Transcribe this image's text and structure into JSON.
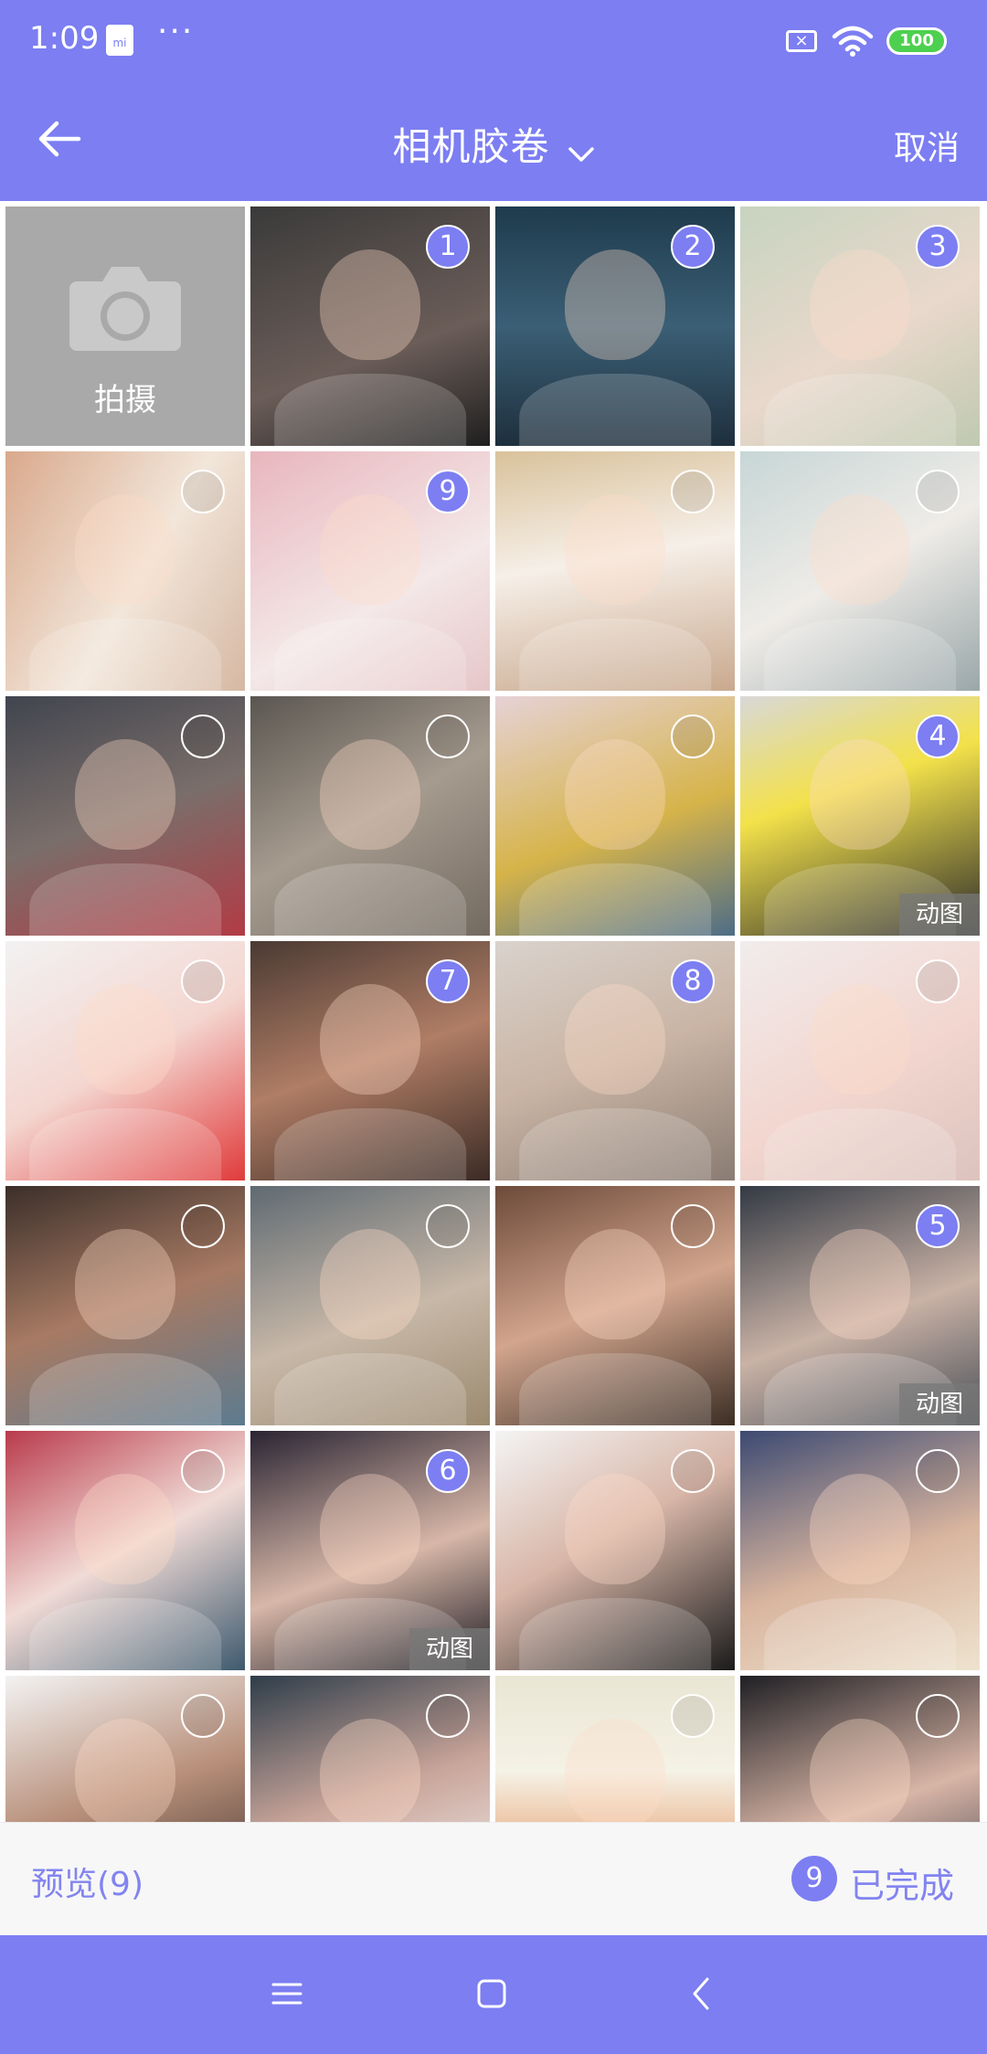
{
  "status": {
    "time": "1:09",
    "battery": "100"
  },
  "header": {
    "title": "相机胶卷",
    "cancel_label": "取消"
  },
  "camera": {
    "label": "拍摄"
  },
  "grid": {
    "photos": [
      {
        "selection": "1",
        "gif": "",
        "bg": "linear-gradient(160deg,#3a3a3a,#6b5d58 60%,#1f1f1f)"
      },
      {
        "selection": "2",
        "gif": "",
        "bg": "linear-gradient(180deg,#1f3b4d,#3b5f75 50%,#1e2f3d)"
      },
      {
        "selection": "3",
        "gif": "",
        "bg": "linear-gradient(150deg,#c7d4c0,#e9d8cc 55%,#bfc9b0)"
      },
      {
        "selection": "",
        "gif": "",
        "bg": "linear-gradient(120deg,#d9a98c,#f2e6da 55%,#d6b8a3)"
      },
      {
        "selection": "9",
        "gif": "",
        "bg": "linear-gradient(150deg,#e8b6bd,#f4e8e8 60%,#e6c6c8)"
      },
      {
        "selection": "",
        "gif": "",
        "bg": "linear-gradient(170deg,#d9c29b,#f6efe8 45%,#c9a98e)"
      },
      {
        "selection": "",
        "gif": "",
        "bg": "linear-gradient(150deg,#c7d6d6,#efece8 50%,#9aa7a9)"
      },
      {
        "selection": "",
        "gif": "",
        "bg": "linear-gradient(160deg,#41454f,#7a6e6a 50%,#b23b45)"
      },
      {
        "selection": "",
        "gif": "",
        "bg": "linear-gradient(150deg,#5a5650,#a69b8f 50%,#736a60)"
      },
      {
        "selection": "",
        "gif": "",
        "bg": "linear-gradient(160deg,#e6d2d6,#d6b44a 55%,#4e6d87)"
      },
      {
        "selection": "4",
        "gif": "动图",
        "bg": "linear-gradient(160deg,#d8d8d8,#f3e14a 40%,#2b2b2b)"
      },
      {
        "selection": "",
        "gif": "",
        "bg": "linear-gradient(150deg,#f2f2f2,#f4d6d0 50%,#e03b3b)"
      },
      {
        "selection": "7",
        "gif": "",
        "bg": "linear-gradient(160deg,#4a3a33,#b07d65 50%,#3b2b25)"
      },
      {
        "selection": "8",
        "gif": "",
        "bg": "linear-gradient(160deg,#d9d2cc,#c9b4a4 50%,#8a7c73)"
      },
      {
        "selection": "",
        "gif": "",
        "bg": "linear-gradient(150deg,#f1ecec,#f2d6cf 55%,#dcc3bd)"
      },
      {
        "selection": "",
        "gif": "",
        "bg": "linear-gradient(160deg,#3b2f2a,#a77a63 50%,#5d7b8f)"
      },
      {
        "selection": "",
        "gif": "",
        "bg": "linear-gradient(160deg,#5f6a72,#c8b8a8 55%,#9b8a6f)"
      },
      {
        "selection": "",
        "gif": "",
        "bg": "linear-gradient(160deg,#6d4a3a,#d2a58d 50%,#3c2e25)"
      },
      {
        "selection": "5",
        "gif": "动图",
        "bg": "linear-gradient(160deg,#333a44,#c9b2a6 55%,#4a4f57)"
      },
      {
        "selection": "",
        "gif": "",
        "bg": "linear-gradient(150deg,#b93b4c,#f1dbd6 50%,#3e5a6e)"
      },
      {
        "selection": "6",
        "gif": "动图",
        "bg": "linear-gradient(160deg,#2a2433,#d7b7a8 55%,#1c1a22)"
      },
      {
        "selection": "",
        "gif": "",
        "bg": "linear-gradient(150deg,#f4f4f4,#d8b6a8 45%,#1b1b1b)"
      },
      {
        "selection": "",
        "gif": "",
        "bg": "linear-gradient(160deg,#3c4a72,#d9b59f 55%,#eee3cf)"
      },
      {
        "selection": "",
        "gif": "",
        "bg": "linear-gradient(160deg,#f3f3f3,#b88f7a 50%,#3a2e2a)"
      },
      {
        "selection": "",
        "gif": "",
        "bg": "linear-gradient(160deg,#2e3d4a,#c9a59a 50%,#f4f4f4)"
      },
      {
        "selection": "",
        "gif": "",
        "bg": "linear-gradient(180deg,#e9e6d4,#f5f2e6 40%,#e07a3b)"
      },
      {
        "selection": "",
        "gif": "",
        "bg": "linear-gradient(160deg,#1f1f24,#d8b5a6 55%,#3a3a48)"
      }
    ]
  },
  "bottom": {
    "preview_label": "预览(9)",
    "selected_count": "9",
    "done_label": "已完成"
  },
  "colors": {
    "accent": "#7c7ef2",
    "accent_text": "#8284f0"
  },
  "icons": {
    "back": "arrow-left-icon",
    "title_caret": "chevron-down-icon",
    "camera": "camera-icon",
    "nav": [
      "menu-icon",
      "home-square-icon",
      "back-chevron-icon"
    ]
  }
}
